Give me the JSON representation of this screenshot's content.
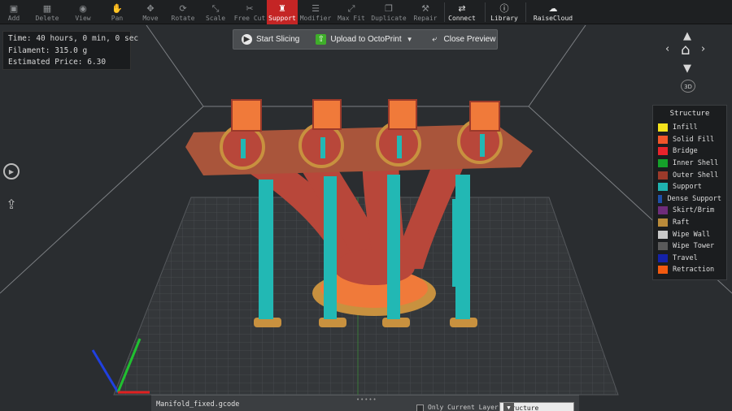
{
  "toolbar": {
    "items": [
      {
        "label": "Add",
        "icon": "cube-add-icon",
        "glyph": "▣"
      },
      {
        "label": "Delete",
        "icon": "cube-delete-icon",
        "glyph": "▦"
      },
      {
        "label": "View",
        "icon": "eye-icon",
        "glyph": "◉"
      },
      {
        "label": "Pan",
        "icon": "hand-icon",
        "glyph": "✋"
      },
      {
        "label": "Move",
        "icon": "move-icon",
        "glyph": "✥"
      },
      {
        "label": "Rotate",
        "icon": "rotate-icon",
        "glyph": "⟳"
      },
      {
        "label": "Scale",
        "icon": "scale-icon",
        "glyph": "⤡"
      },
      {
        "label": "Free Cut",
        "icon": "cut-icon",
        "glyph": "✂"
      },
      {
        "label": "Support",
        "icon": "support-icon",
        "glyph": "♜"
      },
      {
        "label": "Modifier",
        "icon": "modifier-icon",
        "glyph": "☰"
      },
      {
        "label": "Max Fit",
        "icon": "max-fit-icon",
        "glyph": "⤢"
      },
      {
        "label": "Duplicate",
        "icon": "duplicate-icon",
        "glyph": "❐"
      },
      {
        "label": "Repair",
        "icon": "wrench-icon",
        "glyph": "⚒"
      },
      {
        "label": "Connect",
        "icon": "connect-icon",
        "glyph": "⇄"
      },
      {
        "label": "Library",
        "icon": "info-icon",
        "glyph": "ⓘ"
      },
      {
        "label": "RaiseCloud",
        "icon": "cloud-icon",
        "glyph": "☁"
      }
    ],
    "active": "Support"
  },
  "info": {
    "time": "Time: 40 hours, 0 min, 0 sec",
    "filament": "Filament: 315.0 g",
    "price": "Estimated Price: 6.30"
  },
  "actions": {
    "start_slicing": "Start Slicing",
    "upload": "Upload to OctoPrint",
    "close_preview": "Close Preview"
  },
  "legend": {
    "title": "Structure",
    "items": [
      {
        "label": "Infill",
        "color": "#f4e21c"
      },
      {
        "label": "Solid Fill",
        "color": "#f2552a"
      },
      {
        "label": "Bridge",
        "color": "#e8232b"
      },
      {
        "label": "Inner Shell",
        "color": "#15a02a"
      },
      {
        "label": "Outer Shell",
        "color": "#9c3a2a"
      },
      {
        "label": "Support",
        "color": "#1fb3b0"
      },
      {
        "label": "Dense Support",
        "color": "#1f4fa8"
      },
      {
        "label": "Skirt/Brim",
        "color": "#6e2c7a"
      },
      {
        "label": "Raft",
        "color": "#b98a3a"
      },
      {
        "label": "Wipe Wall",
        "color": "#c8c8c8"
      },
      {
        "label": "Wipe Tower",
        "color": "#5a5a5a"
      },
      {
        "label": "Travel",
        "color": "#1422a8"
      },
      {
        "label": "Retraction",
        "color": "#f25a10"
      }
    ]
  },
  "nav": {
    "up": "up-arrow-icon",
    "down": "down-arrow-icon",
    "left": "left-arrow-icon",
    "right": "right-arrow-icon",
    "home": "home-icon",
    "view3d": "3D"
  },
  "bottom": {
    "filename": "Manifold_fixed.gcode",
    "only_current_layer": "Only Current Layer",
    "view_mode": "Structure"
  },
  "colors": {
    "model": "#b8473a",
    "model_top": "#f07a3a",
    "support": "#22b8b4",
    "raft": "#c8913f",
    "active_tool": "#c42525",
    "axis_x": "#e02020",
    "axis_y": "#20c030",
    "axis_z": "#2040e0"
  }
}
